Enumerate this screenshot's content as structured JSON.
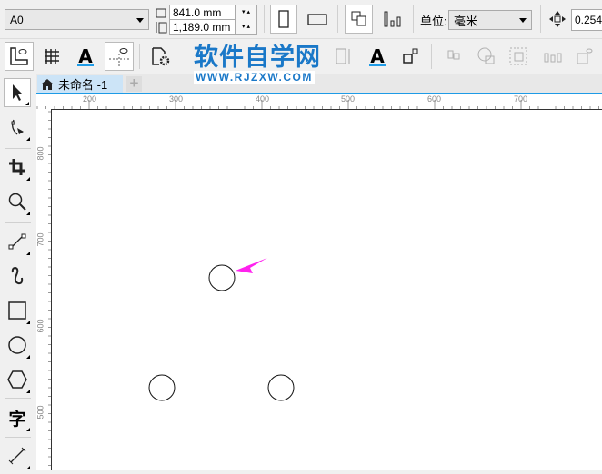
{
  "property_bar": {
    "page_size": "A0",
    "width": "841.0 mm",
    "height": "1,189.0 mm",
    "units_label": "单位:",
    "units_value": "毫米",
    "nudge_value": "0.254"
  },
  "watermark": {
    "title": "软件自学网",
    "url": "WWW.RJZXW.COM"
  },
  "document_tab": {
    "label": "未命名 -1",
    "add_label": "+"
  },
  "ruler": {
    "h_labels": [
      "200",
      "300",
      "400",
      "500",
      "600",
      "700"
    ],
    "v_labels": [
      "800",
      "700",
      "600",
      "500"
    ]
  },
  "colors": {
    "accent": "#1e9be6",
    "arrow": "#ff22ee",
    "tab_bg": "#cce4f7",
    "watermark": "#1a78c8"
  }
}
